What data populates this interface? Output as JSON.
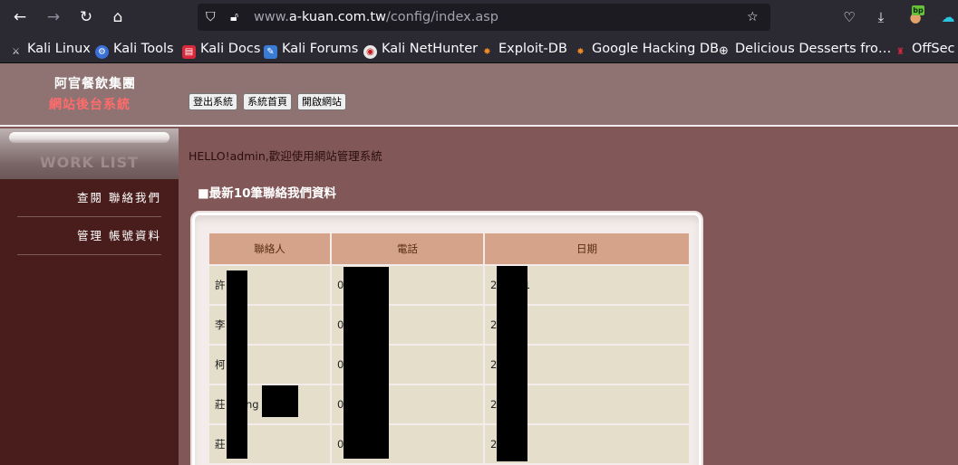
{
  "browser": {
    "url_prefix": "www.",
    "url_host": "a-kuan.com.tw",
    "url_path": "/config/index.asp",
    "extension_badge": "bp",
    "bookmarks": [
      {
        "label": "Kali Linux",
        "icon": "kali-dragon-icon"
      },
      {
        "label": "Kali Tools",
        "icon": "kali-tools-icon"
      },
      {
        "label": "Kali Docs",
        "icon": "kali-docs-icon"
      },
      {
        "label": "Kali Forums",
        "icon": "kali-forums-icon"
      },
      {
        "label": "Kali NetHunter",
        "icon": "nethunter-icon"
      },
      {
        "label": "Exploit-DB",
        "icon": "exploit-db-icon"
      },
      {
        "label": "Google Hacking DB",
        "icon": "ghdb-icon"
      },
      {
        "label": "Delicious Desserts fro…",
        "icon": "globe-icon"
      },
      {
        "label": "OffSec",
        "icon": "offsec-icon"
      }
    ]
  },
  "header": {
    "brand_line1": "阿官餐飲集團",
    "brand_line2": "網站後台系統",
    "buttons": [
      "登出系統",
      "系統首頁",
      "開啟網站"
    ]
  },
  "sidebar": {
    "title": "WORK LIST",
    "items": [
      "查閱 聯絡我們",
      "管理 帳號資料"
    ]
  },
  "main": {
    "greeting": "HELLO!admin,歡迎使用網站管理系統",
    "section_title": "■最新10筆聯絡我們資料",
    "table": {
      "headers": [
        "聯絡人",
        "電話",
        "日期"
      ],
      "rows": [
        [
          "許",
          "09           98",
          "20        2/31"
        ],
        [
          "李",
          "09           35",
          "20        19"
        ],
        [
          "柯",
          "09           38",
          "20        8"
        ],
        [
          "莊        Eri          ng",
          "09           37",
          "20        26"
        ],
        [
          "莊",
          "09           76",
          "20        28"
        ]
      ]
    }
  }
}
